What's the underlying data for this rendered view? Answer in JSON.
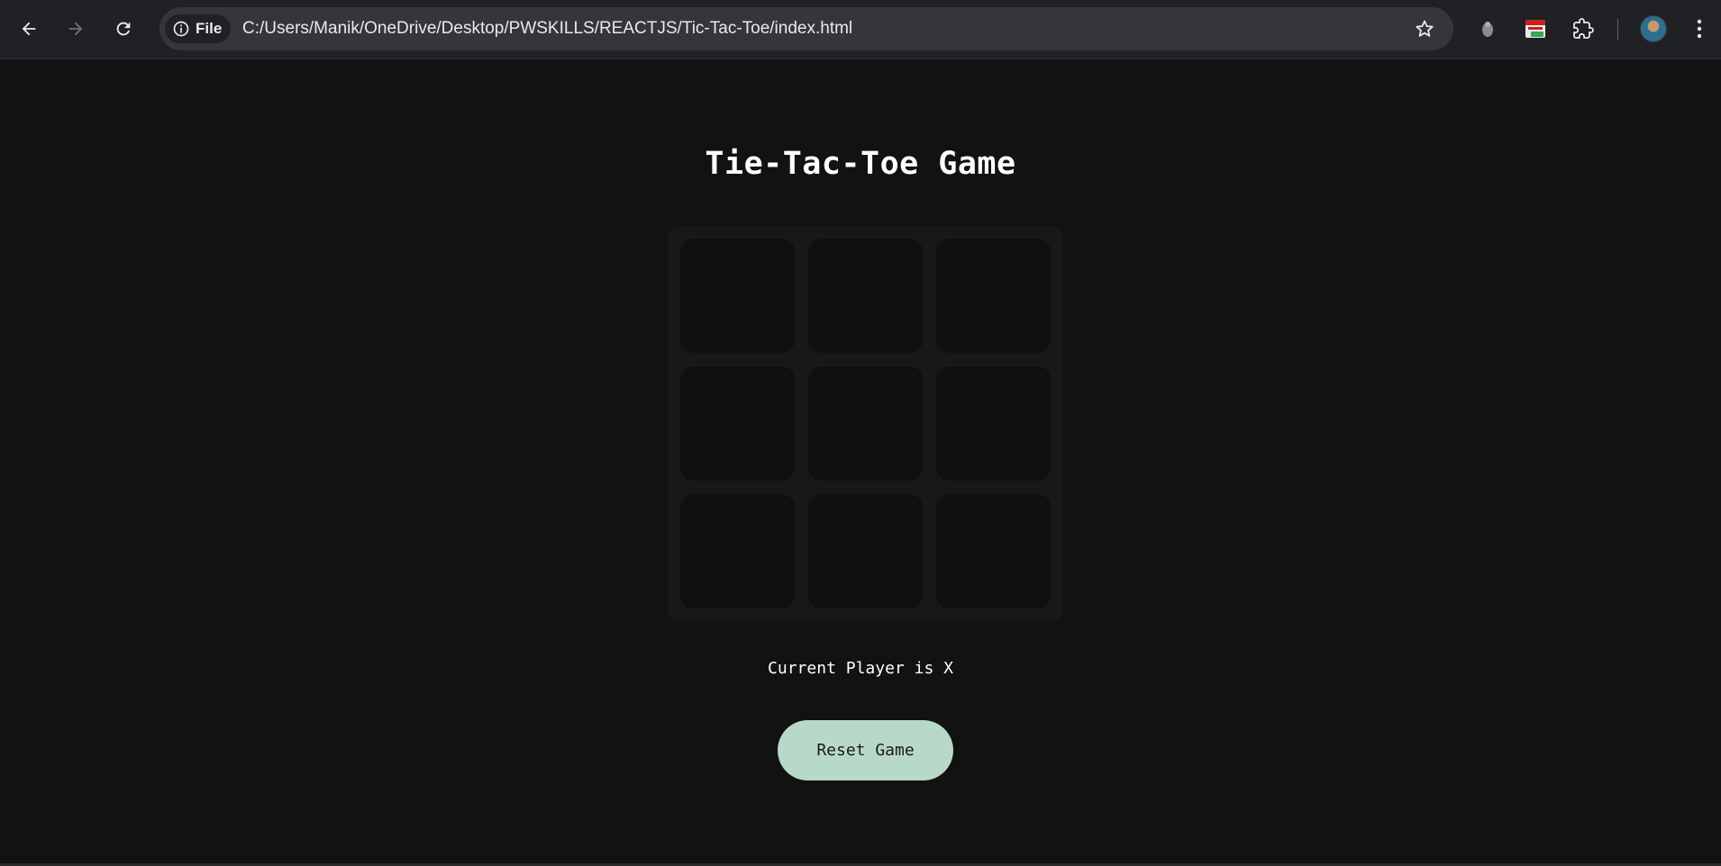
{
  "browser": {
    "back_icon": "arrow-left-icon",
    "forward_icon": "arrow-right-icon",
    "reload_icon": "reload-icon",
    "site_info": {
      "icon": "info-icon",
      "label": "File"
    },
    "url": "C:/Users/Manik/OneDrive/Desktop/PWSKILLS/REACTJS/Tic-Tac-Toe/index.html",
    "bookmark_icon": "star-icon",
    "extensions": [
      "extension-1-icon",
      "extension-2-icon",
      "puzzle-extensions-icon"
    ],
    "menu_icon": "kebab-menu-icon"
  },
  "page": {
    "title": "Tie-Tac-Toe Game",
    "board": {
      "cells": [
        "",
        "",
        "",
        "",
        "",
        "",
        "",
        "",
        ""
      ]
    },
    "status": "Current Player is X",
    "reset_label": "Reset Game"
  },
  "colors": {
    "background": "#121212",
    "board": "#181818",
    "cell": "#101010",
    "reset_button": "#b8d9c7",
    "chrome": "#202124",
    "omnibox": "#35363a"
  }
}
